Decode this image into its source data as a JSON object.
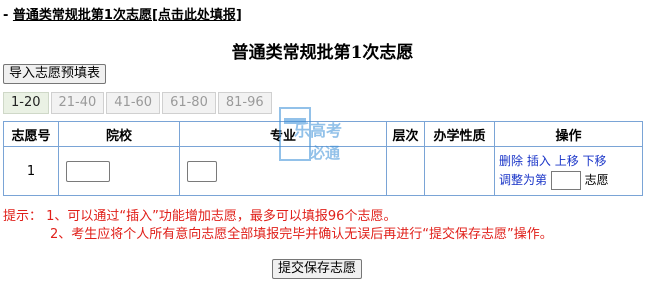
{
  "header": {
    "link_prefix": "- ",
    "link_text": "普通类常规批第1次志愿[点击此处填报]"
  },
  "title": "普通类常规批第1次志愿",
  "import_button": "导入志愿预填表",
  "tabs": [
    {
      "label": "1-20",
      "active": true
    },
    {
      "label": "21-40",
      "active": false
    },
    {
      "label": "41-60",
      "active": false
    },
    {
      "label": "61-80",
      "active": false
    },
    {
      "label": "81-96",
      "active": false
    }
  ],
  "table": {
    "headers": [
      "志愿号",
      "院校",
      "专业",
      "层次",
      "办学性质",
      "操作"
    ],
    "rows": [
      {
        "index": "1",
        "school_value": "",
        "major_value": "",
        "ops": {
          "delete": "删除",
          "insert": "插入",
          "move_up": "上移",
          "move_down": "下移",
          "adjust_prefix": "调整为第",
          "adjust_value": "",
          "adjust_suffix": "志愿"
        }
      }
    ]
  },
  "watermark": {
    "text_line1": "乐高考",
    "text_line2": "必通",
    "color": "#3a8fd8"
  },
  "hints": {
    "label": "提示：",
    "line1": "1、可以通过“插入”功能增加志愿，最多可以填报96个志愿。",
    "line2": "2、考生应将个人所有意向志愿全部填报完毕并确认无误后再进行“提交保存志愿”操作。",
    "color": "#e0201a"
  },
  "submit_button": "提交保存志愿"
}
